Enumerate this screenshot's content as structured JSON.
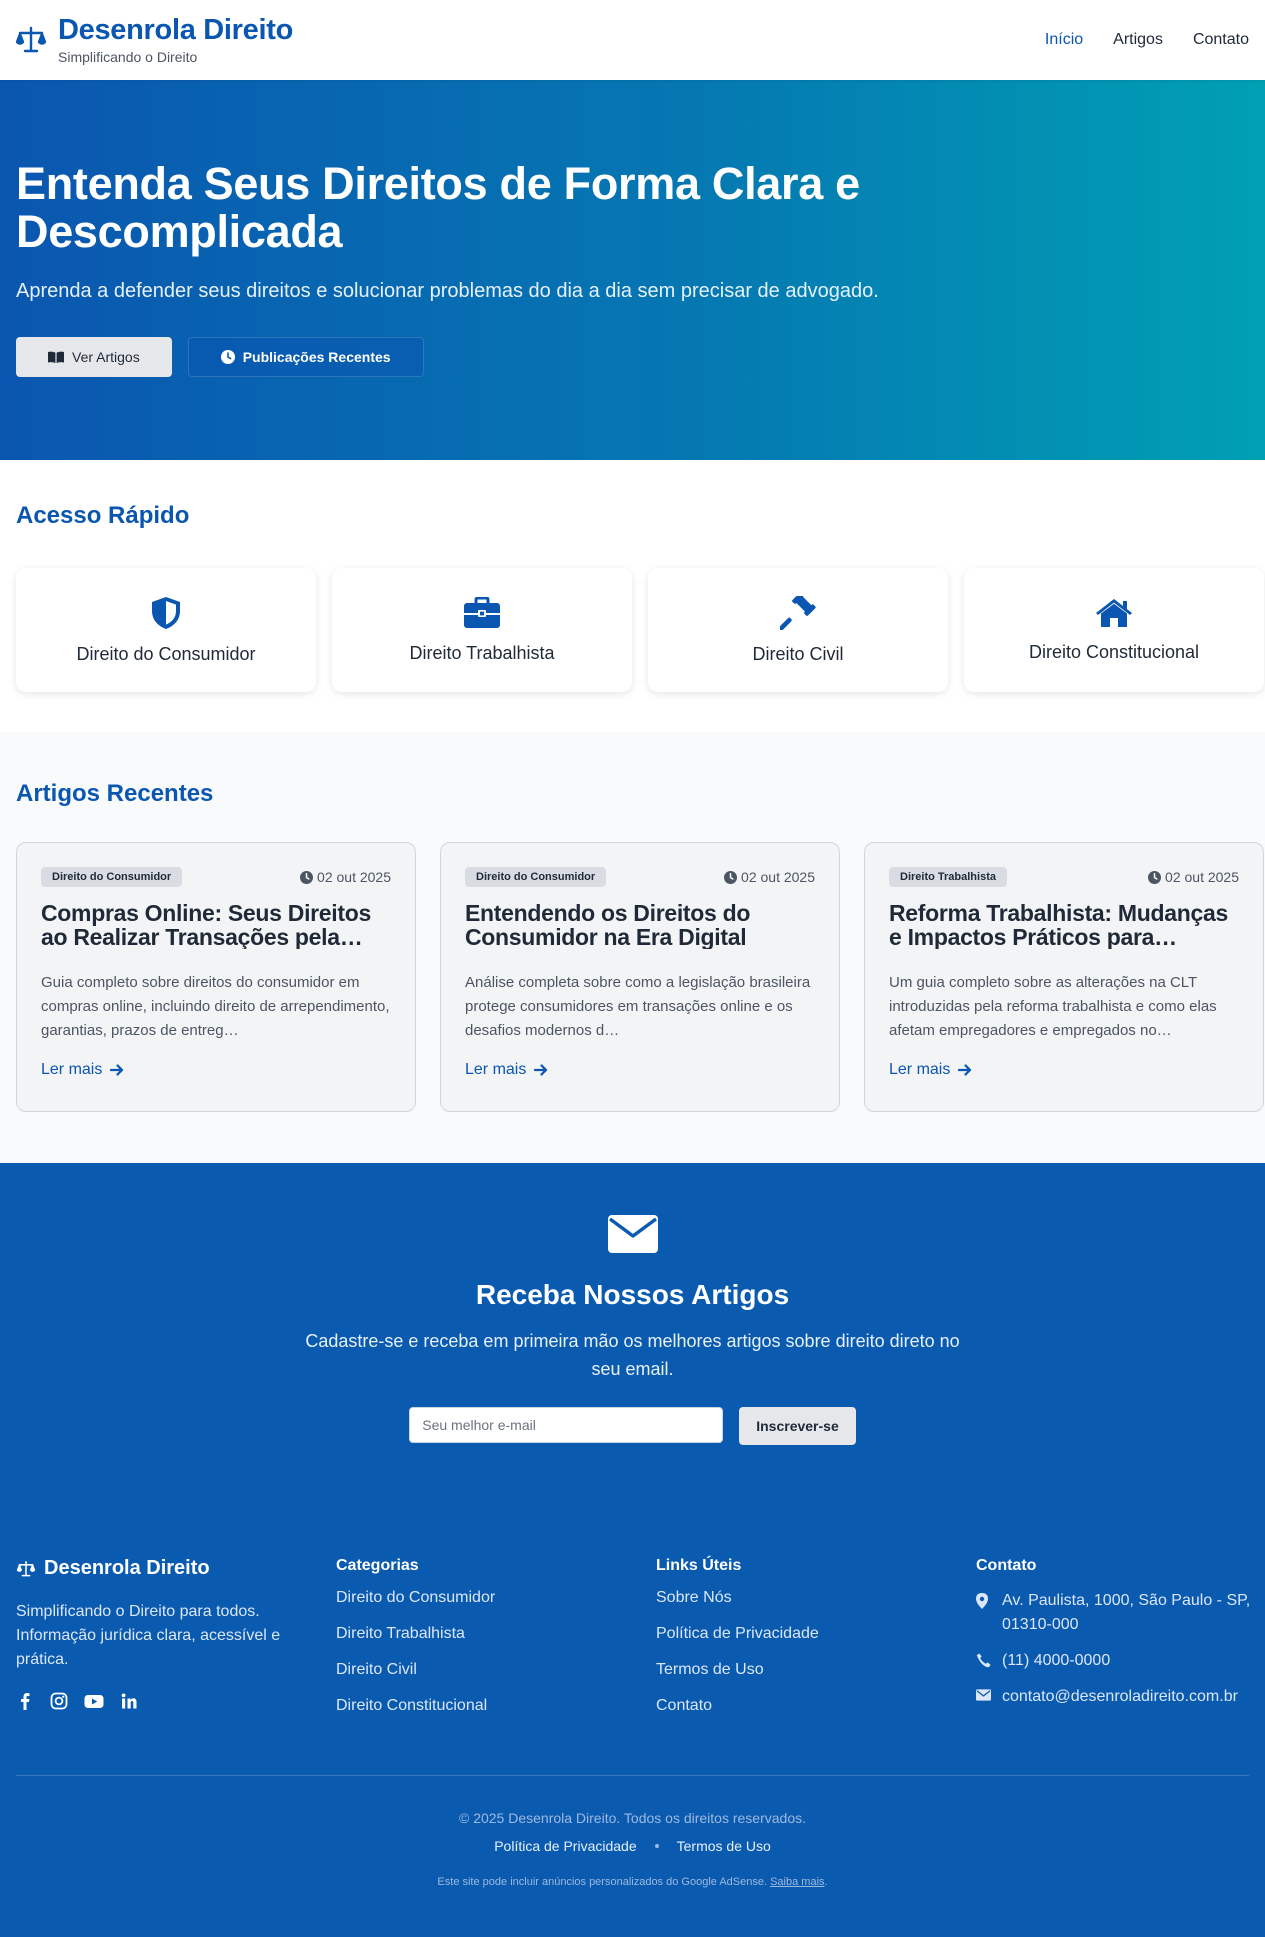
{
  "header": {
    "brand_title": "Desenrola Direito",
    "brand_subtitle": "Simplificando o Direito",
    "nav": [
      "Início",
      "Artigos",
      "Contato"
    ],
    "brand_icon": "scale-balance-icon"
  },
  "hero": {
    "title": "Entenda Seus Direitos de Forma Clara e Descomplicada",
    "subtitle": "Aprenda a defender seus direitos e solucionar problemas do dia a dia sem precisar de advogado.",
    "primary_button": "Ver Artigos",
    "secondary_button": "Publicações Recentes"
  },
  "quick_access": {
    "title": "Acesso Rápido",
    "cards": [
      {
        "label": "Direito do Consumidor",
        "icon": "shield-icon"
      },
      {
        "label": "Direito Trabalhista",
        "icon": "briefcase-icon"
      },
      {
        "label": "Direito Civil",
        "icon": "gavel-icon"
      },
      {
        "label": "Direito Constitucional",
        "icon": "house-icon"
      }
    ]
  },
  "articles": {
    "title": "Artigos Recentes",
    "read_more": "Ler mais",
    "items": [
      {
        "category": "Direito do Consumidor",
        "date": "02 out 2025",
        "title": "Compras Online: Seus Direitos ao Realizar Transações pela…",
        "description": "Guia completo sobre direitos do consumidor em compras online, incluindo direito de arrependimento, garantias, prazos de entreg…"
      },
      {
        "category": "Direito do Consumidor",
        "date": "02 out 2025",
        "title": "Entendendo os Direitos do Consumidor na Era Digital",
        "description": "Análise completa sobre como a legislação brasileira protege consumidores em transações online e os desafios modernos d…"
      },
      {
        "category": "Direito Trabalhista",
        "date": "02 out 2025",
        "title": "Reforma Trabalhista: Mudanças e Impactos Práticos para…",
        "description": "Um guia completo sobre as alterações na CLT introduzidas pela reforma trabalhista e como elas afetam empregadores e empregados no…"
      }
    ]
  },
  "newsletter": {
    "title": "Receba Nossos Artigos",
    "text": "Cadastre-se e receba em primeira mão os melhores artigos sobre direito direto no seu email.",
    "placeholder": "Seu melhor e-mail",
    "button": "Inscrever-se"
  },
  "footer": {
    "brand": "Desenrola Direito",
    "description": "Simplificando o Direito para todos. Informação jurídica clara, acessível e prática.",
    "categories_title": "Categorias",
    "categories": [
      "Direito do Consumidor",
      "Direito Trabalhista",
      "Direito Civil",
      "Direito Constitucional"
    ],
    "links_title": "Links Úteis",
    "links": [
      "Sobre Nós",
      "Política de Privacidade",
      "Termos de Uso",
      "Contato"
    ],
    "contact_title": "Contato",
    "address": "Av. Paulista, 1000, São Paulo - SP, 01310-000",
    "phone": "(11) 4000-0000",
    "email": "contato@desenroladireito.com.br",
    "copyright": "© 2025 Desenrola Direito. Todos os direitos reservados.",
    "bottom_links": [
      "Política de Privacidade",
      "Termos de Uso"
    ],
    "adsense_text": "Este site pode incluir anúncios personalizados do Google AdSense.",
    "adsense_link": "Saiba mais",
    "adsense_end": "."
  },
  "colors": {
    "brand": "#0a56b0",
    "hero_gradient_start": "#0a56b0",
    "hero_gradient_end": "#00a0b4",
    "footer_bg": "#0a5ab0"
  }
}
